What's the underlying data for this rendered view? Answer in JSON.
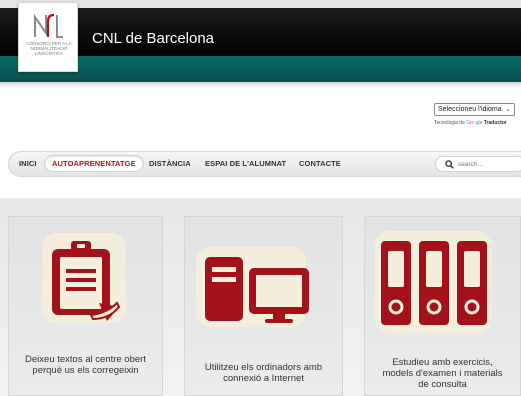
{
  "header": {
    "site_title": "CNL de Barcelona",
    "logo_text": "CONSORCI PER A LA NORMALITZACIÓ LINGÜÍSTICA"
  },
  "language": {
    "select_label": "Seleccioneu l'idioma",
    "powered_prefix": "Tecnologia de",
    "google_word": [
      "G",
      "o",
      "o",
      "g",
      "l",
      "e"
    ],
    "powered_suffix": "Traductor"
  },
  "nav": {
    "items": [
      "INICI",
      "AUTOAPRENENTATGE",
      "DISTÀNCIA",
      "ESPAI DE L'ALUMNAT",
      "CONTACTE"
    ],
    "active_index": 1,
    "search_placeholder": "search..."
  },
  "cards": [
    {
      "caption_line1": "Deixeu textos al centre obert",
      "caption_line2": "perquè us els corregeixin",
      "caption_line3": "",
      "icon": "clipboard-document-icon"
    },
    {
      "caption_line1": "Utilitzeu els ordinadors amb",
      "caption_line2": "connexió a Internet",
      "caption_line3": "",
      "icon": "computer-icon"
    },
    {
      "caption_line1": "Estudieu amb exercicis,",
      "caption_line2": "models d'examen i materials",
      "caption_line3": "de consulta",
      "icon": "binders-icon"
    }
  ],
  "colors": {
    "accent_red": "#b0141e",
    "teal": "#0a5957",
    "icon_red": "#a3121b",
    "icon_cream": "#f4eedc"
  }
}
